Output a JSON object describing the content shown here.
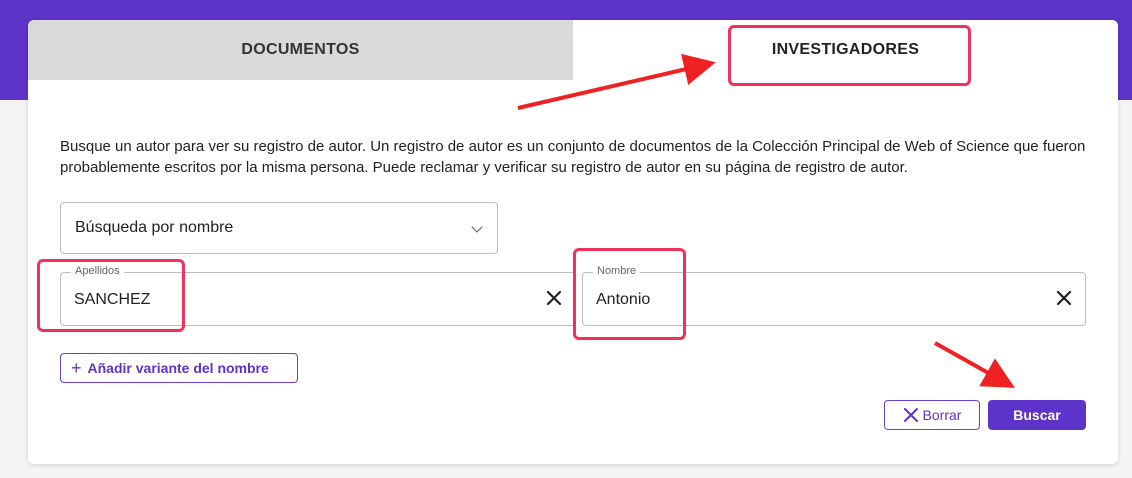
{
  "tabs": {
    "documents": "DOCUMENTOS",
    "researchers": "INVESTIGADORES"
  },
  "description": "Busque un autor para ver su registro de autor. Un registro de autor es un conjunto de documentos de la Colección Principal de Web of Science que fueron probablemente escritos por la misma persona. Puede reclamar y verificar su registro de autor en su página de registro de autor.",
  "search_type": {
    "selected": "Búsqueda por nombre"
  },
  "fields": {
    "surname": {
      "label": "Apellidos",
      "value": "SANCHEZ"
    },
    "name": {
      "label": "Nombre",
      "value": "Antonio"
    }
  },
  "buttons": {
    "add_variant": "Añadir variante del nombre",
    "clear": "Borrar",
    "search": "Buscar"
  },
  "colors": {
    "brand": "#5e33c9",
    "highlight": "#f0325a",
    "arrow": "#ee2222"
  }
}
